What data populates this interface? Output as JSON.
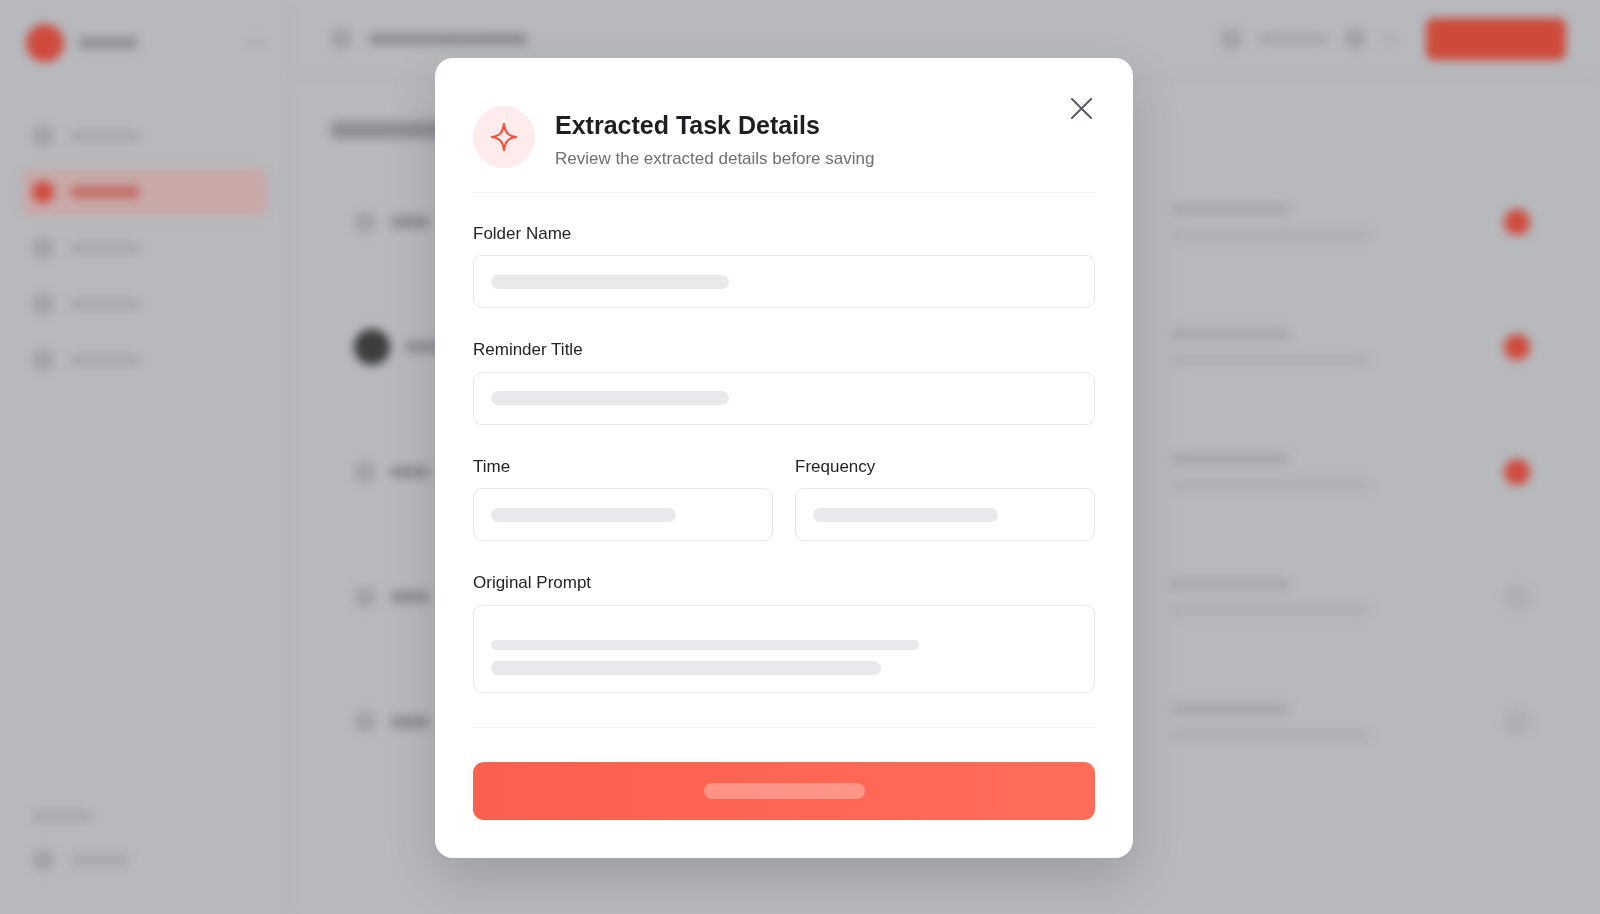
{
  "dialog": {
    "title": "Extracted Task Details",
    "subtitle": "Review the extracted details before saving",
    "field_rows": [
      {
        "fields": [
          {
            "label": "Folder Name",
            "kind": "input",
            "loading": true
          }
        ]
      },
      {
        "fields": [
          {
            "label": "Reminder Title",
            "kind": "input",
            "loading": true
          }
        ]
      },
      {
        "fields": [
          {
            "label": "Time",
            "kind": "input",
            "loading": true
          },
          {
            "label": "Frequency",
            "kind": "input",
            "loading": true
          }
        ]
      },
      {
        "fields": [
          {
            "label": "Original Prompt",
            "kind": "textarea",
            "loading": true
          }
        ]
      }
    ],
    "submit_button": {
      "loading": true
    }
  }
}
